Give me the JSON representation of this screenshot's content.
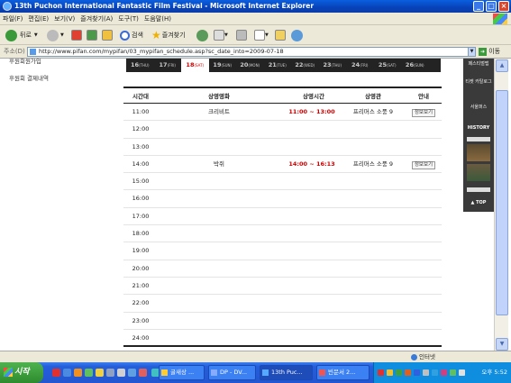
{
  "window": {
    "title": "13th Puchon International Fantastic Film Festival - Microsoft Internet Explorer"
  },
  "menu": [
    "파일(F)",
    "편집(E)",
    "보기(V)",
    "즐겨찾기(A)",
    "도구(T)",
    "도움말(H)"
  ],
  "toolbar": {
    "back": "뒤로",
    "search": "검색",
    "favorites": "즐겨찾기"
  },
  "address": {
    "label": "주소(D)",
    "url": "http://www.pifan.com/mypifan/03_mypifan_schedule.asp?sc_date_into=2009-07-18",
    "go": "이동"
  },
  "leftnav": [
    "후원회원가입",
    "후원회 결제내역"
  ],
  "dates": [
    {
      "num": "16",
      "dow": "THU",
      "selected": false
    },
    {
      "num": "17",
      "dow": "FRI",
      "selected": false
    },
    {
      "num": "18",
      "dow": "SAT",
      "selected": true
    },
    {
      "num": "19",
      "dow": "SUN",
      "selected": false
    },
    {
      "num": "20",
      "dow": "MON",
      "selected": false
    },
    {
      "num": "21",
      "dow": "TUE",
      "selected": false
    },
    {
      "num": "22",
      "dow": "WED",
      "selected": false
    },
    {
      "num": "23",
      "dow": "THU",
      "selected": false
    },
    {
      "num": "24",
      "dow": "FRI",
      "selected": false
    },
    {
      "num": "25",
      "dow": "SAT",
      "selected": false
    },
    {
      "num": "26",
      "dow": "SUN",
      "selected": false
    }
  ],
  "schedule": {
    "headers": {
      "time": "시간대",
      "film": "상영영화",
      "showtime": "상영시간",
      "venue": "상영관",
      "info": "안내"
    },
    "rows": [
      {
        "time": "11:00",
        "film": "크리비트",
        "showtime": "11:00 ~ 13:00",
        "venue": "프리머스 소풍 9",
        "info": "정보보기"
      },
      {
        "time": "12:00",
        "film": "",
        "showtime": "",
        "venue": "",
        "info": ""
      },
      {
        "time": "13:00",
        "film": "",
        "showtime": "",
        "venue": "",
        "info": ""
      },
      {
        "time": "14:00",
        "film": "박쥐",
        "showtime": "14:00 ~ 16:13",
        "venue": "프리머스 소풍 9",
        "info": "정보보기"
      },
      {
        "time": "15:00",
        "film": "",
        "showtime": "",
        "venue": "",
        "info": ""
      },
      {
        "time": "16:00",
        "film": "",
        "showtime": "",
        "venue": "",
        "info": ""
      },
      {
        "time": "17:00",
        "film": "",
        "showtime": "",
        "venue": "",
        "info": ""
      },
      {
        "time": "18:00",
        "film": "",
        "showtime": "",
        "venue": "",
        "info": ""
      },
      {
        "time": "19:00",
        "film": "",
        "showtime": "",
        "venue": "",
        "info": ""
      },
      {
        "time": "20:00",
        "film": "",
        "showtime": "",
        "venue": "",
        "info": ""
      },
      {
        "time": "21:00",
        "film": "",
        "showtime": "",
        "venue": "",
        "info": ""
      },
      {
        "time": "22:00",
        "film": "",
        "showtime": "",
        "venue": "",
        "info": ""
      },
      {
        "time": "23:00",
        "film": "",
        "showtime": "",
        "venue": "",
        "info": ""
      },
      {
        "time": "24:00",
        "film": "",
        "showtime": "",
        "venue": "",
        "info": ""
      }
    ]
  },
  "rightside": {
    "items": [
      "페스티벌맵",
      "티켓 카탈로그",
      "서울퍼스"
    ],
    "history": "HISTORY",
    "top": "▲ TOP"
  },
  "statusbar": {
    "zone": "인터넷"
  },
  "taskbar": {
    "start": "시작",
    "tasks": [
      "굴새상 ...",
      "DP - DV...",
      "13th Puc...",
      "빈문서 2..."
    ],
    "clock": "오후 5:52"
  },
  "colors": {
    "accent_red": "#cc0000",
    "datebar_bg": "#232323",
    "xp_blue": "#245edb"
  }
}
